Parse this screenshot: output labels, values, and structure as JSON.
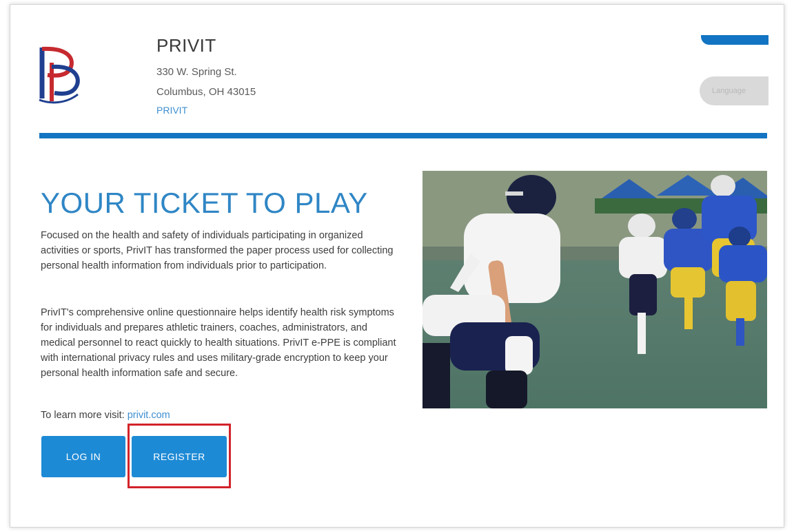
{
  "brand": {
    "logo_letters": "PP",
    "name": "PRIVIT",
    "address_line1": "330 W. Spring St.",
    "address_line2": "Columbus, OH 43015",
    "link_text": "PRIVIT"
  },
  "header": {
    "language_button_label": "Language"
  },
  "main": {
    "headline": "YOUR TICKET TO PLAY",
    "paragraph1": "Focused on the health and safety of individuals participating in organized activities or sports, PrivIT has transformed the paper process used for collecting personal health information from individuals prior to participation.",
    "paragraph2": "PrivIT's comprehensive online questionnaire helps identify health risk symptoms for individuals and prepares athletic trainers, coaches, administrators, and medical personnel to react quickly to health situations. PrivIT e-PPE is compliant with international privacy rules and uses military-grade encryption to keep your personal health information safe and secure.",
    "learn_more_prefix": "To learn more visit:",
    "learn_more_link": "privit.com",
    "login_label": "LOG IN",
    "register_label": "REGISTER"
  },
  "colors": {
    "primary": "#1274c2",
    "button": "#1d8ad5",
    "headline": "#2f86c5",
    "highlight": "#d2232a",
    "logo_red": "#c62a2f",
    "logo_blue": "#1f3f8f"
  },
  "icons": {
    "logo": "privit-pp-monogram",
    "hero": "football-players-photo"
  }
}
